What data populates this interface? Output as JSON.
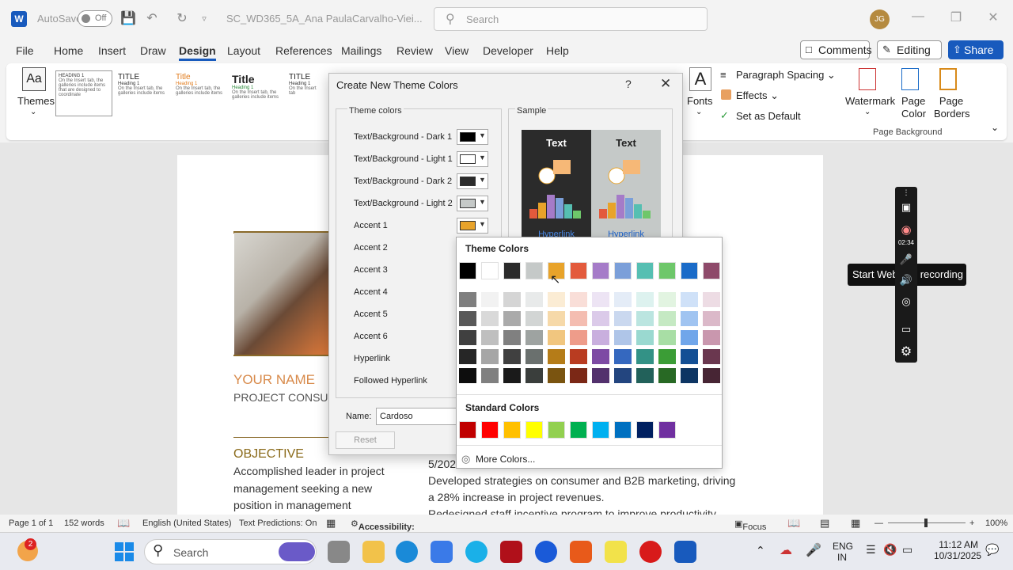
{
  "titlebar": {
    "autosave_label": "AutoSave",
    "autosave_state": "Off",
    "doc_title": "SC_WD365_5A_Ana PaulaCarvalho-Viei...",
    "search_placeholder": "Search",
    "avatar_initials": "JG"
  },
  "menu": {
    "items": [
      "File",
      "Home",
      "Insert",
      "Draw",
      "Design",
      "Layout",
      "References",
      "Mailings",
      "Review",
      "View",
      "Developer",
      "Help"
    ],
    "active": "Design",
    "comments": "Comments",
    "editing": "Editing",
    "share": "Share"
  },
  "ribbon": {
    "themes": "Themes",
    "gallery": [
      {
        "title": "",
        "heading": "HEADING 1"
      },
      {
        "title": "TITLE",
        "heading": "Heading 1"
      },
      {
        "title": "Title",
        "heading": "Heading 1"
      },
      {
        "title": "Title",
        "heading": "Heading 1"
      },
      {
        "title": "TITLE",
        "heading": "Heading 1"
      }
    ],
    "fonts": "Fonts",
    "paragraph_spacing": "Paragraph Spacing",
    "effects": "Effects",
    "set_as_default": "Set as Default",
    "watermark": "Watermark",
    "page_color": "Page Color",
    "page_borders": "Page Borders",
    "page_background_group": "Page Background"
  },
  "document": {
    "your_name": "YOUR NAME",
    "project_consult": "PROJECT CONSULT",
    "objective_heading": "OBJECTIVE",
    "objective_lines": [
      "Accomplished leader in project",
      "management seeking a new",
      "position in management"
    ],
    "right_lines": [
      "5/202",
      "Developed strategies on consumer and B2B marketing, driving",
      "a 28% increase in project revenues.",
      "Redesigned staff incentive program to improve productivity"
    ]
  },
  "dialog": {
    "title": "Create New Theme Colors",
    "help": "?",
    "theme_colors_legend": "Theme colors",
    "sample_legend": "Sample",
    "rows": [
      {
        "label": "Text/Background - Dark 1",
        "color": "#000000"
      },
      {
        "label": "Text/Background - Light 1",
        "color": "#ffffff"
      },
      {
        "label": "Text/Background - Dark 2",
        "color": "#2b2b2b"
      },
      {
        "label": "Text/Background - Light 2",
        "color": "#c5c9c8"
      },
      {
        "label": "Accent 1",
        "color": "#e8a32a"
      },
      {
        "label": "Accent 2",
        "color": ""
      },
      {
        "label": "Accent 3",
        "color": ""
      },
      {
        "label": "Accent 4",
        "color": ""
      },
      {
        "label": "Accent 5",
        "color": ""
      },
      {
        "label": "Accent 6",
        "color": ""
      },
      {
        "label": "Hyperlink",
        "color": ""
      },
      {
        "label": "Followed Hyperlink",
        "color": ""
      }
    ],
    "sample_text": "Text",
    "sample_link": "Hyperlink",
    "name_label": "Name:",
    "name_value": "Cardoso",
    "reset": "Reset"
  },
  "picker": {
    "theme_heading": "Theme Colors",
    "standard_heading": "Standard Colors",
    "more_colors": "More Colors...",
    "theme_colors": [
      "#000000",
      "#ffffff",
      "#2b2b2b",
      "#c5c9c8",
      "#e8a32a",
      "#e35a3c",
      "#a57bc8",
      "#7b9fd9",
      "#56bfb2",
      "#6ec76a",
      "#1a6bc8",
      "#8e4a6a"
    ],
    "shade_columns": [
      [
        "#7f7f7f",
        "#595959",
        "#404040",
        "#262626",
        "#0d0d0d"
      ],
      [
        "#f2f2f2",
        "#d9d9d9",
        "#bfbfbf",
        "#a6a6a6",
        "#808080"
      ],
      [
        "#d5d5d5",
        "#aaaaaa",
        "#808080",
        "#404040",
        "#1a1a1a"
      ],
      [
        "#e8eaea",
        "#d2d5d4",
        "#9ea3a1",
        "#6a706e",
        "#3a3e3c"
      ],
      [
        "#fbecd4",
        "#f6d9a9",
        "#f1c67f",
        "#b57c18",
        "#7a5410"
      ],
      [
        "#f9ded8",
        "#f4bdb1",
        "#ee9c8a",
        "#b93c21",
        "#7b2816"
      ],
      [
        "#ede4f4",
        "#dbcae9",
        "#c9afde",
        "#7d4aa4",
        "#53316d"
      ],
      [
        "#e4ecf7",
        "#cad8ef",
        "#afc5e8",
        "#3568bf",
        "#23457f"
      ],
      [
        "#ddf2ef",
        "#bbe5e0",
        "#9ad9d0",
        "#339286",
        "#22615a"
      ],
      [
        "#e2f4e1",
        "#c5e9c3",
        "#a8dea5",
        "#3b9d36",
        "#286924"
      ],
      [
        "#cfe1f8",
        "#a0c4f1",
        "#70a6ea",
        "#134f95",
        "#0d3563"
      ],
      [
        "#eddce4",
        "#dbb9c9",
        "#c997ae",
        "#6a374f",
        "#472534"
      ]
    ],
    "standard_colors": [
      "#c00000",
      "#ff0000",
      "#ffc000",
      "#ffff00",
      "#92d050",
      "#00b050",
      "#00b0f0",
      "#0070c0",
      "#002060",
      "#7030a0"
    ]
  },
  "recorder": {
    "time": "02:34",
    "tooltip": "Start Webcam recording"
  },
  "statusbar": {
    "page": "Page 1 of 1",
    "words": "152 words",
    "language": "English (United States)",
    "predictions": "Text Predictions: On",
    "accessibility": "Accessibility: Investigate",
    "focus": "Focus",
    "zoom": "100%"
  },
  "taskbar": {
    "search": "Search",
    "notification_badge": "2",
    "lang_top": "ENG",
    "lang_bottom": "IN",
    "time": "11:12 AM",
    "date": "10/31/2025"
  }
}
